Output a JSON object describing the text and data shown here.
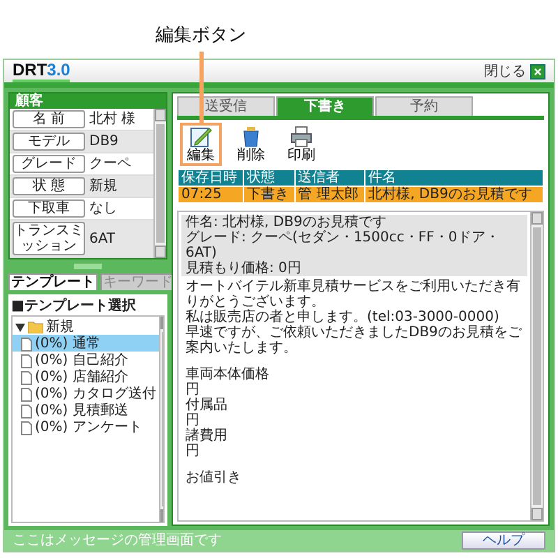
{
  "annotation": {
    "label": "編集ボタン"
  },
  "window": {
    "logo": "DRT",
    "logo_version": "3.0",
    "close_label": "閉じる"
  },
  "customer": {
    "title": "顧客",
    "fields": [
      {
        "label": "名 前",
        "value": "北村 様"
      },
      {
        "label": "モデル",
        "value": "DB9"
      },
      {
        "label": "グレード",
        "value": "クーペ"
      },
      {
        "label": "状 態",
        "value": "新規"
      },
      {
        "label": "下取車",
        "value": "なし"
      },
      {
        "label": "トランスミッション",
        "value": "6AT"
      }
    ]
  },
  "left_tabs": [
    {
      "label": "テンプレート",
      "selected": true
    },
    {
      "label": "キーワード",
      "selected": false
    }
  ],
  "template_heading": "■テンプレート選択",
  "template_tree": [
    {
      "label": "新規",
      "expanded": true,
      "children": [
        {
          "label": "(0%) 通常",
          "selected": true
        },
        {
          "label": "(0%) 自己紹介",
          "selected": false
        },
        {
          "label": "(0%) 店舗紹介",
          "selected": false
        },
        {
          "label": "(0%) カタログ送付",
          "selected": false
        },
        {
          "label": "(0%) 見積郵送",
          "selected": false
        },
        {
          "label": "(0%) アンケート",
          "selected": false
        }
      ]
    }
  ],
  "tabs": [
    {
      "label": "送受信",
      "selected": false
    },
    {
      "label": "下書き",
      "selected": true
    },
    {
      "label": "予約",
      "selected": false
    }
  ],
  "toolbar": [
    {
      "kind": "edit",
      "label": "編集",
      "highlighted": true
    },
    {
      "kind": "delete",
      "label": "削除",
      "highlighted": false
    },
    {
      "kind": "print",
      "label": "印刷",
      "highlighted": false
    }
  ],
  "table": {
    "columns": [
      "保存日時",
      "状態",
      "送信者",
      "件名"
    ],
    "rows": [
      {
        "cells": [
          "07:25",
          "下書き",
          "管 理太郎",
          "北村様, DB9のお見積です"
        ],
        "selected": true
      }
    ]
  },
  "message": {
    "header_lines": [
      "件名: 北村様, DB9のお見積です",
      "グレード: クーペ(セダン・1500cc・FF・0ドア・6AT)",
      "見積もり価格: 0円"
    ],
    "paragraphs": [
      [
        "オートバイテル新車見積サービスをご利用いただき有りがとうございます。",
        "私は販売店の者と申します。(tel:03-3000-0000)",
        "早速ですが、ご依頼いただきましたDB9のお見積をご案内いたします。"
      ],
      [
        "車両本体価格",
        "円",
        "付属品",
        "円",
        "諸費用",
        "円"
      ],
      [
        "お値引き"
      ]
    ]
  },
  "status_bar": {
    "text": "ここはメッセージの管理画面です",
    "help_label": "ヘルプ"
  }
}
